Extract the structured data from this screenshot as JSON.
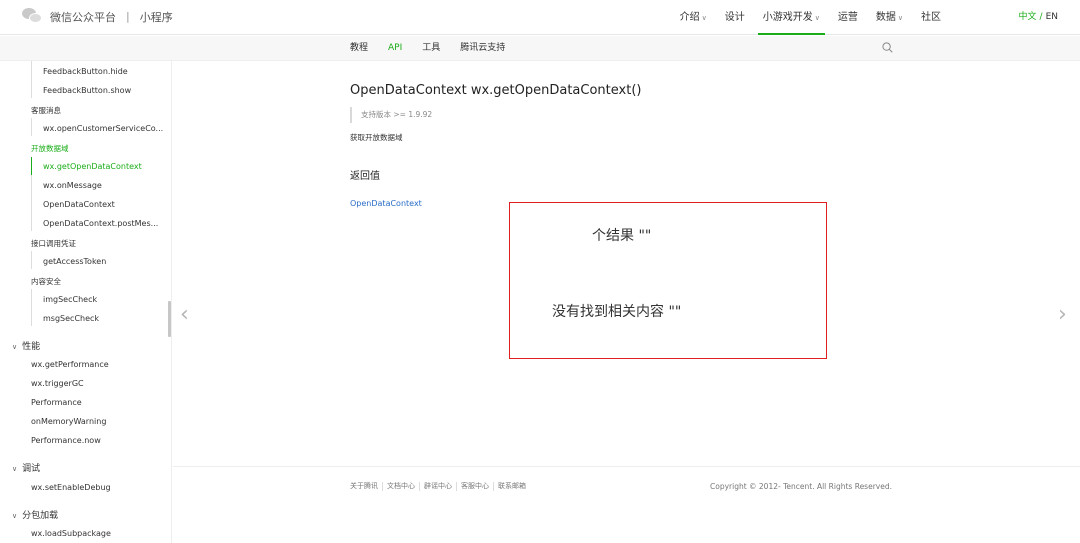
{
  "header": {
    "logo_text": "微信公众平台",
    "logo_sep": "|",
    "logo_sub": "小程序",
    "nav": [
      {
        "label": "介绍",
        "chevron": true
      },
      {
        "label": "设计",
        "chevron": false
      },
      {
        "label": "小游戏开发",
        "chevron": true,
        "active": true
      },
      {
        "label": "运营",
        "chevron": false
      },
      {
        "label": "数据",
        "chevron": true
      },
      {
        "label": "社区",
        "chevron": false
      }
    ],
    "lang_zh": "中文",
    "lang_slash": "/",
    "lang_en": "EN",
    "accent_color": "#1aad19"
  },
  "subnav": {
    "items": [
      "教程",
      "API",
      "工具",
      "腾讯云支持"
    ],
    "active_index": 1
  },
  "sidebar": {
    "items": [
      {
        "label": "FeedbackButton.hide"
      },
      {
        "label": "FeedbackButton.show"
      },
      {
        "label": "客服消息"
      },
      {
        "label": "wx.openCustomerServiceCo..."
      },
      {
        "label": "开放数据域"
      },
      {
        "label": "wx.getOpenDataContext"
      },
      {
        "label": "wx.onMessage"
      },
      {
        "label": "OpenDataContext"
      },
      {
        "label": "OpenDataContext.postMes..."
      },
      {
        "label": "接口调用凭证"
      },
      {
        "label": "getAccessToken"
      },
      {
        "label": "内容安全"
      },
      {
        "label": "imgSecCheck"
      },
      {
        "label": "msgSecCheck"
      },
      {
        "label": "性能"
      },
      {
        "label": "wx.getPerformance"
      },
      {
        "label": "wx.triggerGC"
      },
      {
        "label": "Performance"
      },
      {
        "label": "onMemoryWarning"
      },
      {
        "label": "Performance.now"
      },
      {
        "label": "调试"
      },
      {
        "label": "wx.setEnableDebug"
      },
      {
        "label": "分包加载"
      },
      {
        "label": "wx.loadSubpackage"
      }
    ]
  },
  "main": {
    "title": "OpenDataContext wx.getOpenDataContext()",
    "version": "支持版本 >= 1.9.92",
    "description": "获取开放数据域",
    "return_title": "返回值",
    "return_link": "OpenDataContext"
  },
  "search_overlay": {
    "result_count": "个结果 \"\"",
    "no_result": "没有找到相关内容 \"\""
  },
  "footer": {
    "links": [
      "关于腾讯",
      "文档中心",
      "辟谣中心",
      "客服中心",
      "联系邮箱"
    ],
    "copyright": "Copyright © 2012- Tencent. All Rights Reserved."
  },
  "icons": {
    "search": "search-icon",
    "prev": "chevron-left-icon",
    "next": "chevron-right-icon",
    "logo": "wechat-logo-icon"
  }
}
